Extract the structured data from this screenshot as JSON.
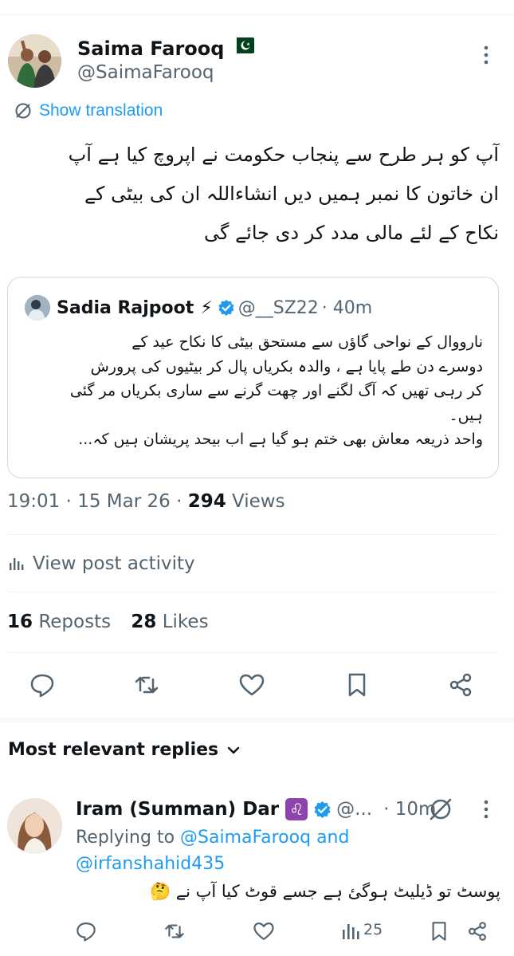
{
  "post": {
    "author": {
      "name": "Saima Farooq",
      "flag": "🇵🇰",
      "handle": "@SaimaFarooq"
    },
    "show_translation": "Show translation",
    "text_lines": [
      "آپ کو ہر طرح سے پنجاب حکومت نے اپروچ کیا ہے آپ",
      "ان خاتون کا نمبر ہمیں دیں انشاءاللہ  ان کی بیٹی کے",
      "نکاح کے لئے  مالی مدد کر دی جائے گی"
    ],
    "quote": {
      "name": "Sadia Rajpoot",
      "emoji": "⚡",
      "handle": "@__SZ22",
      "time": "· 40m",
      "text_lines": [
        "نارووال کے نواحی گاؤں سے  مستحق بیٹی کا نکاح عید کے",
        "دوسرے دن طے پایا ہے ، والدہ بکریاں پال کر  بیٹیوں کی پرورش",
        "کر رہی تھیں کہ آگ لگنے اور چھت گرنے سے ساری بکریاں مر گئی",
        "ہیں۔",
        "واحد ذریعہ معاش بھی ختم ہو گیا ہے اب بیحد پریشان ہیں کہ..."
      ]
    },
    "timestamp": "19:01 · 15 Mar 26 · ",
    "views_count": "294",
    "views_label": " Views",
    "view_activity": "View post activity",
    "reposts_count": "16",
    "reposts_label": " Reposts",
    "likes_count": "28",
    "likes_label": " Likes"
  },
  "replies_heading": "Most relevant replies",
  "reply": {
    "name": "Iram (Summan) Dar",
    "sign": "♌",
    "handle": "@...",
    "time": "· 10m",
    "replying_prefix": "Replying to ",
    "replying_user1": "@SaimaFarooq",
    "replying_and": " and",
    "replying_user2": "@irfanshahid435",
    "text": "پوسٹ تو ڈیلیٹ ہوگئ ہے جسے قوٹ کیا آپ نے 🤔",
    "views": "25"
  },
  "colors": {
    "accent": "#1d9bf0",
    "muted": "#536471",
    "verified": "#1d9bf0",
    "divider": "#eff3f4"
  },
  "icons": {
    "actions": [
      "reply-icon",
      "repost-icon",
      "like-icon",
      "bookmark-icon",
      "share-icon"
    ],
    "header": [
      "more-icon"
    ],
    "translation": "translate-icon",
    "activity": "analytics-icon"
  }
}
